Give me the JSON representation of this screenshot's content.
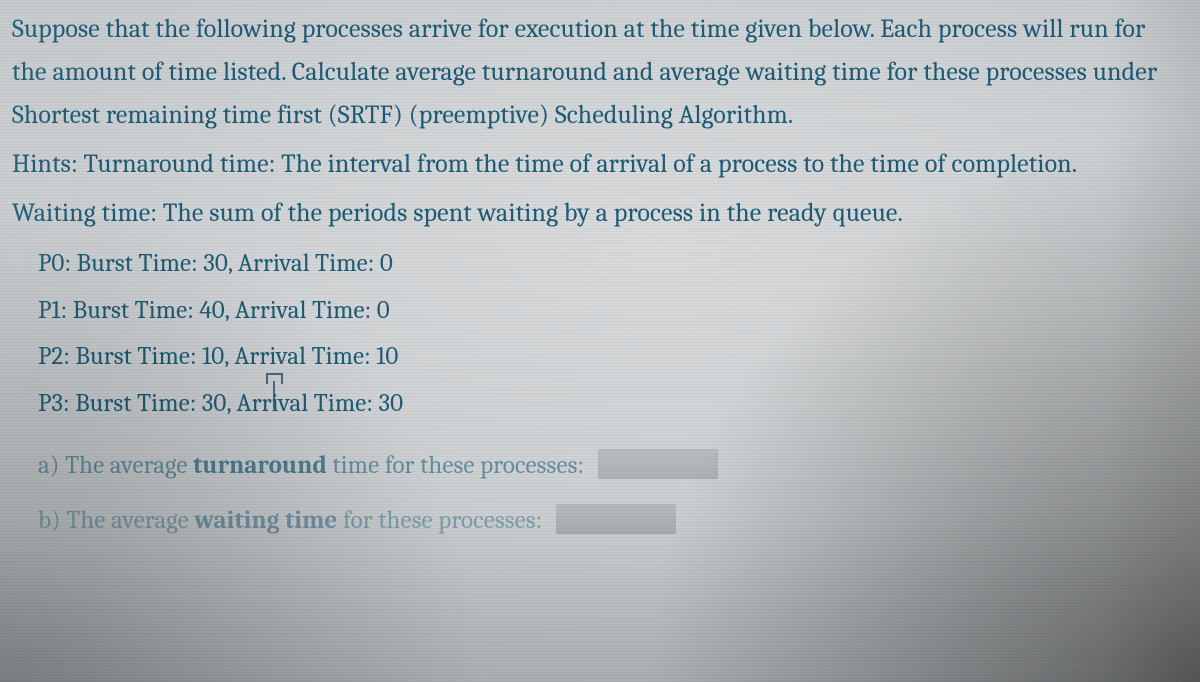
{
  "intro": "Suppose that the following processes arrive for execution at the time given below. Each process will run for the amount of time listed. Calculate average turnaround and average waiting time for these processes under Shortest remaining time first (SRTF) (preemptive) Scheduling Algorithm.",
  "hints": "Hints: Turnaround time: The interval from the time of arrival of a process to the time of completion.",
  "waiting_def": "Waiting time: The sum of the periods spent waiting by a process in the ready queue.",
  "processes": [
    {
      "name": "P0",
      "burst": 30,
      "arrival": 0
    },
    {
      "name": "P1",
      "burst": 40,
      "arrival": 0
    },
    {
      "name": "P2",
      "burst": 10,
      "arrival": 10
    },
    {
      "name": "P3",
      "burst": 30,
      "arrival": 30
    }
  ],
  "proc_lines": {
    "p0": "P0: Burst Time: 30, Arrival Time: 0",
    "p1": "P1: Burst Time: 40, Arrival Time: 0",
    "p2": "P2: Burst Time: 10, Arrival Time: 10",
    "p3_a": "P3: Burst Time: 30, Ar",
    "p3_b": "ival Time: 30"
  },
  "answers": {
    "a_prefix": "a) The average ",
    "a_bold": "turnaround",
    "a_suffix": " time for these processes:",
    "b_prefix": "b) The average ",
    "b_bold": "waiting time",
    "b_suffix": " for these processes:"
  }
}
